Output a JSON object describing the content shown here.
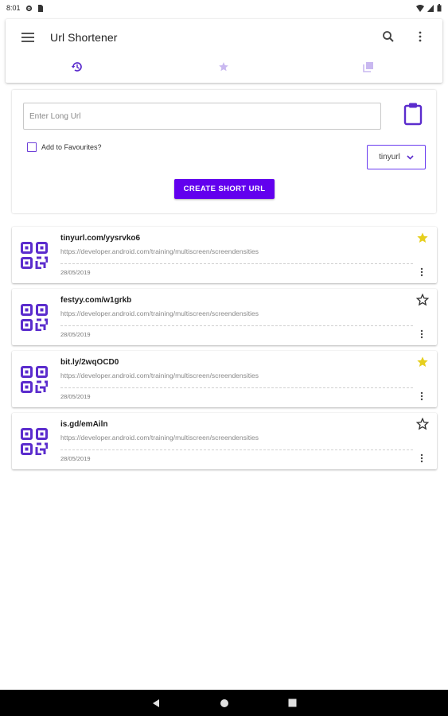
{
  "status_bar": {
    "time": "8:01"
  },
  "app_bar": {
    "title": "Url Shortener"
  },
  "tabs": [
    {
      "name": "history",
      "icon": "history-icon",
      "selected": true
    },
    {
      "name": "favourites",
      "icon": "star-icon",
      "selected": false
    },
    {
      "name": "collections",
      "icon": "collections-icon",
      "selected": false
    }
  ],
  "form": {
    "url_placeholder": "Enter Long Url",
    "url_value": "",
    "favourites_label": "Add to Favourites?",
    "favourites_checked": false,
    "service_selected": "tinyurl",
    "create_button": "CREATE SHORT URL"
  },
  "urls": [
    {
      "short": "tinyurl.com/yysrvko6",
      "long": "https://developer.android.com/training/multiscreen/screendensities",
      "date": "28/05/2019",
      "favourite": true
    },
    {
      "short": "festyy.com/w1grkb",
      "long": "https://developer.android.com/training/multiscreen/screendensities",
      "date": "28/05/2019",
      "favourite": false
    },
    {
      "short": "bit.ly/2wqOCD0",
      "long": "https://developer.android.com/training/multiscreen/screendensities",
      "date": "28/05/2019",
      "favourite": true
    },
    {
      "short": "is.gd/emAiln",
      "long": "https://developer.android.com/training/multiscreen/screendensities",
      "date": "28/05/2019",
      "favourite": false
    }
  ],
  "colors": {
    "primary": "#6200ee",
    "icon_purple": "#5b2ccd",
    "tab_inactive": "#c9b8f0",
    "star_active": "#e6cf1e"
  }
}
